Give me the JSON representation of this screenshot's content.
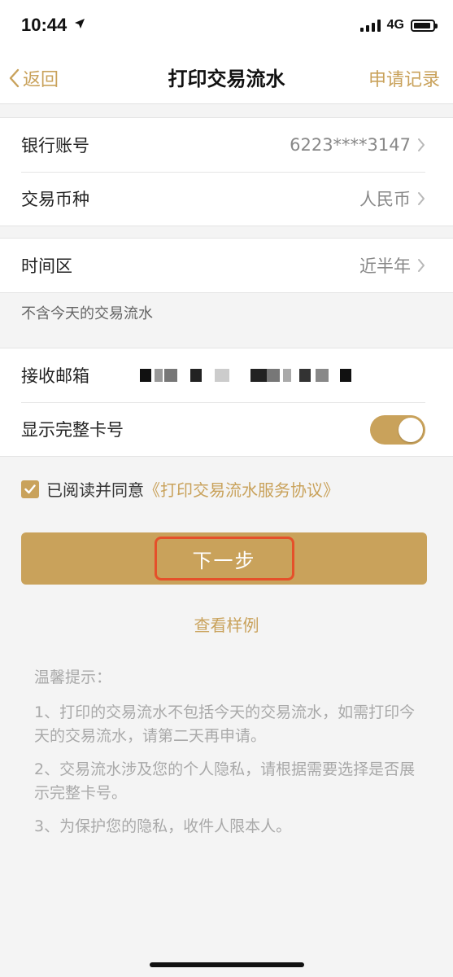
{
  "status": {
    "time": "10:44",
    "network": "4G"
  },
  "nav": {
    "back_label": "返回",
    "title": "打印交易流水",
    "right_label": "申请记录"
  },
  "account": {
    "bank_label": "银行账号",
    "bank_value": "6223****3147",
    "currency_label": "交易币种",
    "currency_value": "人民币"
  },
  "period": {
    "label": "时间区",
    "value": "近半年",
    "note": "不含今天的交易流水"
  },
  "email": {
    "label": "接收邮箱"
  },
  "fullcard": {
    "label": "显示完整卡号",
    "enabled": true
  },
  "agreement": {
    "prefix": "已阅读并同意",
    "link": "《打印交易流水服务协议》",
    "checked": true
  },
  "next_button": {
    "label": "下一步"
  },
  "sample_link": "查看样例",
  "tips": {
    "title": "温馨提示：",
    "items": [
      "1、打印的交易流水不包括今天的交易流水，如需打印今天的交易流水，请第二天再申请。",
      "2、交易流水涉及您的个人隐私，请根据需要选择是否展示完整卡号。",
      "3、为保护您的隐私，收件人限本人。"
    ]
  },
  "colors": {
    "accent": "#c9a25b",
    "highlight": "#e5502a",
    "background": "#f4f4f4"
  }
}
